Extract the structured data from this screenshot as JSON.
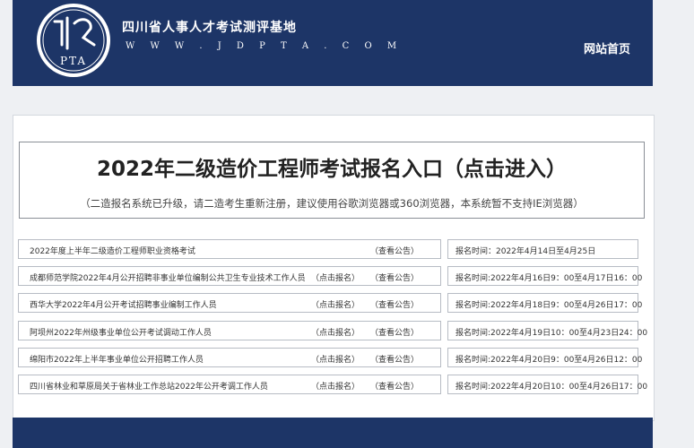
{
  "header": {
    "logo_text": "PTA",
    "site_title": "四川省人事人才考试测评基地",
    "site_url": "W W W . J D P T A . C O M",
    "home_link": "网站首页"
  },
  "main": {
    "title": "2022年二级造价工程师考试报名入口（点击进入）",
    "notice": "（二造报名系统已升级，请二造考生重新注册，建议使用谷歌浏览器或360浏览器，本系统暂不支持IE浏览器）"
  },
  "rows": [
    {
      "name": "2022年度上半年二级造价工程师职业资格考试",
      "apply": "",
      "view": "（查看公告）",
      "time": "报名时间：2022年4月14日至4月25日"
    },
    {
      "name": "成都师范学院2022年4月公开招聘非事业单位编制公共卫生专业技术工作人员",
      "apply": "（点击报名）",
      "view": "（查看公告）",
      "time": "报名时间:2022年4月16日9：00至4月17日16：00"
    },
    {
      "name": "西华大学2022年4月公开考试招聘事业编制工作人员",
      "apply": "（点击报名）",
      "view": "（查看公告）",
      "time": "报名时间:2022年4月18日9：00至4月26日17：00"
    },
    {
      "name": "阿坝州2022年州级事业单位公开考试调动工作人员",
      "apply": "（点击报名）",
      "view": "（查看公告）",
      "time": "报名时间:2022年4月19日10：00至4月23日24：00"
    },
    {
      "name": "绵阳市2022年上半年事业单位公开招聘工作人员",
      "apply": "（点击报名）",
      "view": "（查看公告）",
      "time": "报名时间:2022年4月20日9：00至4月26日12：00"
    },
    {
      "name": "四川省林业和草原局关于省林业工作总站2022年公开考调工作人员",
      "apply": "（点击报名）",
      "view": "（查看公告）",
      "time": "报名时间:2022年4月20日10：00至4月26日17：00"
    }
  ]
}
